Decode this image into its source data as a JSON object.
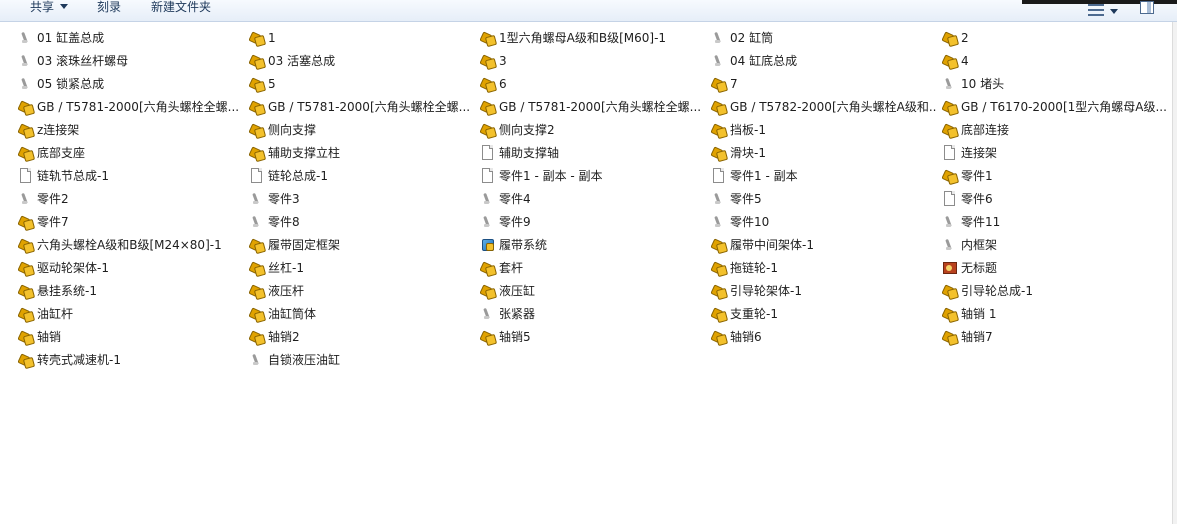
{
  "toolbar": {
    "share_label": "共享",
    "burn_label": "刻录",
    "new_folder_label": "新建文件夹"
  },
  "colors": {
    "toolbar_bg": "#e6eef8",
    "toolbar_text": "#1e395b",
    "assembly_icon": "#f3c12c",
    "file_text": "#1e1e1e"
  },
  "files": [
    {
      "name": "01 缸盖总成",
      "icon": "part-file-icon"
    },
    {
      "name": "1",
      "icon": "assembly-file-icon"
    },
    {
      "name": "1型六角螺母A级和B级[M60]-1",
      "icon": "assembly-file-icon"
    },
    {
      "name": "02 缸筒",
      "icon": "part-file-icon"
    },
    {
      "name": "2",
      "icon": "assembly-file-icon"
    },
    {
      "name": "03 滚珠丝杆螺母",
      "icon": "part-file-icon"
    },
    {
      "name": "03 活塞总成",
      "icon": "assembly-file-icon"
    },
    {
      "name": "3",
      "icon": "assembly-file-icon"
    },
    {
      "name": "04 缸底总成",
      "icon": "part-file-icon"
    },
    {
      "name": "4",
      "icon": "assembly-file-icon"
    },
    {
      "name": "05 锁紧总成",
      "icon": "part-file-icon"
    },
    {
      "name": "5",
      "icon": "assembly-file-icon"
    },
    {
      "name": "6",
      "icon": "assembly-file-icon"
    },
    {
      "name": "7",
      "icon": "assembly-file-icon"
    },
    {
      "name": "10 堵头",
      "icon": "part-file-icon"
    },
    {
      "name": "GB / T5781-2000[六角头螺栓全螺...",
      "icon": "assembly-file-icon"
    },
    {
      "name": "GB / T5781-2000[六角头螺栓全螺...",
      "icon": "assembly-file-icon"
    },
    {
      "name": "GB / T5781-2000[六角头螺栓全螺...",
      "icon": "assembly-file-icon"
    },
    {
      "name": "GB / T5782-2000[六角头螺栓A级和...",
      "icon": "assembly-file-icon"
    },
    {
      "name": "GB / T6170-2000[1型六角螺母A级...",
      "icon": "assembly-file-icon"
    },
    {
      "name": "z连接架",
      "icon": "assembly-file-icon"
    },
    {
      "name": "侧向支撑",
      "icon": "assembly-file-icon"
    },
    {
      "name": "侧向支撑2",
      "icon": "assembly-file-icon"
    },
    {
      "name": "挡板-1",
      "icon": "assembly-file-icon"
    },
    {
      "name": "底部连接",
      "icon": "assembly-file-icon"
    },
    {
      "name": "底部支座",
      "icon": "assembly-file-icon"
    },
    {
      "name": "辅助支撑立柱",
      "icon": "assembly-file-icon"
    },
    {
      "name": "辅助支撑轴",
      "icon": "document-file-icon"
    },
    {
      "name": "滑块-1",
      "icon": "assembly-file-icon"
    },
    {
      "name": "连接架",
      "icon": "document-file-icon"
    },
    {
      "name": "链轨节总成-1",
      "icon": "document-file-icon"
    },
    {
      "name": "链轮总成-1",
      "icon": "document-file-icon"
    },
    {
      "name": "零件1 - 副本 - 副本",
      "icon": "document-file-icon"
    },
    {
      "name": "零件1 - 副本",
      "icon": "document-file-icon"
    },
    {
      "name": "零件1",
      "icon": "assembly-file-icon"
    },
    {
      "name": "零件2",
      "icon": "part-file-icon"
    },
    {
      "name": "零件3",
      "icon": "part-file-icon"
    },
    {
      "name": "零件4",
      "icon": "part-file-icon"
    },
    {
      "name": "零件5",
      "icon": "part-file-icon"
    },
    {
      "name": "零件6",
      "icon": "document-file-icon"
    },
    {
      "name": "零件7",
      "icon": "assembly-file-icon"
    },
    {
      "name": "零件8",
      "icon": "part-file-icon"
    },
    {
      "name": "零件9",
      "icon": "part-file-icon"
    },
    {
      "name": "零件10",
      "icon": "part-file-icon"
    },
    {
      "name": "零件11",
      "icon": "part-file-icon"
    },
    {
      "name": "六角头螺栓A级和B级[M24×80]-1",
      "icon": "assembly-file-icon"
    },
    {
      "name": "履带固定框架",
      "icon": "assembly-file-icon"
    },
    {
      "name": "履带系统",
      "icon": "blue-assembly-icon"
    },
    {
      "name": "履带中间架体-1",
      "icon": "assembly-file-icon"
    },
    {
      "name": "内框架",
      "icon": "part-file-icon"
    },
    {
      "name": "驱动轮架体-1",
      "icon": "assembly-file-icon"
    },
    {
      "name": "丝杠-1",
      "icon": "assembly-file-icon"
    },
    {
      "name": "套杆",
      "icon": "assembly-file-icon"
    },
    {
      "name": "拖链轮-1",
      "icon": "assembly-file-icon"
    },
    {
      "name": "无标题",
      "icon": "image-file-icon"
    },
    {
      "name": "悬挂系统-1",
      "icon": "assembly-file-icon"
    },
    {
      "name": "液压杆",
      "icon": "assembly-file-icon"
    },
    {
      "name": "液压缸",
      "icon": "assembly-file-icon"
    },
    {
      "name": "引导轮架体-1",
      "icon": "assembly-file-icon"
    },
    {
      "name": "引导轮总成-1",
      "icon": "assembly-file-icon"
    },
    {
      "name": "油缸杆",
      "icon": "assembly-file-icon"
    },
    {
      "name": "油缸筒体",
      "icon": "assembly-file-icon"
    },
    {
      "name": "张紧器",
      "icon": "part-file-icon"
    },
    {
      "name": "支重轮-1",
      "icon": "assembly-file-icon"
    },
    {
      "name": "轴销 1",
      "icon": "assembly-file-icon"
    },
    {
      "name": "轴销",
      "icon": "assembly-file-icon"
    },
    {
      "name": "轴销2",
      "icon": "assembly-file-icon"
    },
    {
      "name": "轴销5",
      "icon": "assembly-file-icon"
    },
    {
      "name": "轴销6",
      "icon": "assembly-file-icon"
    },
    {
      "name": "轴销7",
      "icon": "assembly-file-icon"
    },
    {
      "name": "转壳式减速机-1",
      "icon": "assembly-file-icon"
    },
    {
      "name": "自锁液压油缸",
      "icon": "part-file-icon"
    }
  ]
}
